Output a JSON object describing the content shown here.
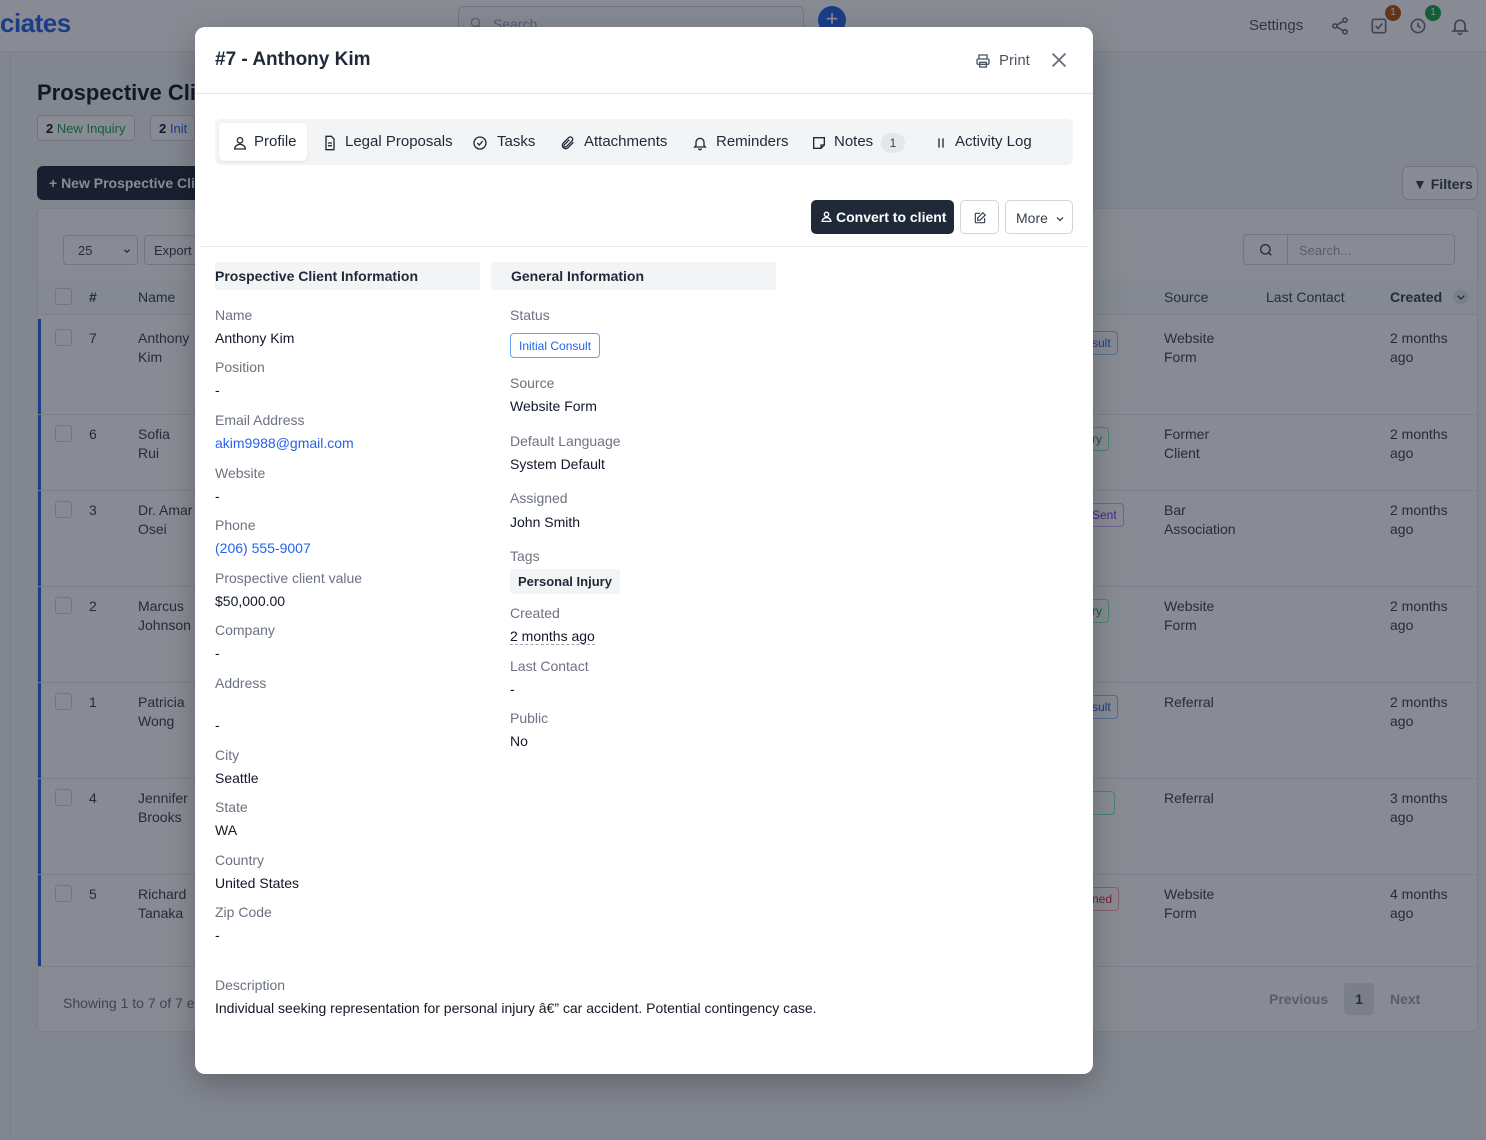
{
  "app": {
    "brand": "ciates",
    "search_placeholder": "Search",
    "settings_label": "Settings",
    "task_badge": "1",
    "timer_badge": "1",
    "page_title": "Prospective Clie",
    "chips": [
      {
        "count": "2",
        "label": "New Inquiry"
      },
      {
        "count": "2",
        "label": "Init"
      }
    ],
    "new_button": "+ New Prospective Cli",
    "filters_button": "Filters",
    "per_page": "25",
    "export_label": "Export",
    "table_search_placeholder": "Search...",
    "columns": {
      "num": "#",
      "name": "Name",
      "source": "Source",
      "last_contact": "Last Contact",
      "created": "Created"
    },
    "rows": [
      {
        "num": "7",
        "name": "Anthony Kim",
        "status": "sult",
        "source": "Website Form",
        "created": "2 months ago"
      },
      {
        "num": "6",
        "name": "Sofia Rui",
        "status": "ry",
        "source": "Former Client",
        "created": "2 months ago"
      },
      {
        "num": "3",
        "name": "Dr. Amar Osei",
        "status": "Sent",
        "source": "Bar Association",
        "created": "2 months ago"
      },
      {
        "num": "2",
        "name": "Marcus Johnson",
        "status": "ry",
        "source": "Website Form",
        "created": "2 months ago"
      },
      {
        "num": "1",
        "name": "Patricia Wong",
        "status": "sult",
        "source": "Referral",
        "created": "2 months ago"
      },
      {
        "num": "4",
        "name": "Jennifer Brooks",
        "status": "",
        "source": "Referral",
        "created": "3 months ago"
      },
      {
        "num": "5",
        "name": "Richard Tanaka",
        "status": "ned",
        "source": "Website Form",
        "created": "4 months ago"
      }
    ],
    "showing": "Showing 1 to 7 of 7 e",
    "pager": {
      "prev": "Previous",
      "current": "1",
      "next": "Next"
    }
  },
  "modal": {
    "title": "#7 - Anthony Kim",
    "print_label": "Print",
    "tabs": [
      {
        "id": "profile",
        "label": "Profile",
        "icon": "user-icon"
      },
      {
        "id": "legal-proposals",
        "label": "Legal Proposals",
        "icon": "document-icon"
      },
      {
        "id": "tasks",
        "label": "Tasks",
        "icon": "check-circle-icon"
      },
      {
        "id": "attachments",
        "label": "Attachments",
        "icon": "paperclip-icon"
      },
      {
        "id": "reminders",
        "label": "Reminders",
        "icon": "bell-icon"
      },
      {
        "id": "notes",
        "label": "Notes",
        "icon": "note-icon",
        "badge": "1"
      },
      {
        "id": "activity-log",
        "label": "Activity Log",
        "icon": "activity-icon"
      }
    ],
    "convert_button": "Convert to client",
    "more_button": "More",
    "left_section": {
      "title": "Prospective Client Information",
      "name_label": "Name",
      "name": "Anthony Kim",
      "position_label": "Position",
      "position": "-",
      "email_label": "Email Address",
      "email": "akim9988@gmail.com",
      "website_label": "Website",
      "website": "-",
      "phone_label": "Phone",
      "phone": "(206) 555-9007",
      "value_label": "Prospective client value",
      "value": "$50,000.00",
      "company_label": "Company",
      "company": "-",
      "address_label": "Address",
      "address": "-",
      "city_label": "City",
      "city": "Seattle",
      "state_label": "State",
      "state": "WA",
      "country_label": "Country",
      "country": "United States",
      "zip_label": "Zip Code",
      "zip": "-"
    },
    "right_section": {
      "title": "General Information",
      "status_label": "Status",
      "status": "Initial Consult",
      "source_label": "Source",
      "source": "Website Form",
      "language_label": "Default Language",
      "language": "System Default",
      "assigned_label": "Assigned",
      "assigned": "John Smith",
      "tags_label": "Tags",
      "tag": "Personal Injury",
      "created_label": "Created",
      "created": "2 months ago",
      "last_contact_label": "Last Contact",
      "last_contact": "-",
      "public_label": "Public",
      "public": "No"
    },
    "description_label": "Description",
    "description": "Individual seeking representation for personal injury â€” car accident. Potential contingency case."
  },
  "colors": {
    "accent": "#2563eb",
    "dark_button": "#1f2937",
    "active_row_bar": "#2563eb"
  }
}
